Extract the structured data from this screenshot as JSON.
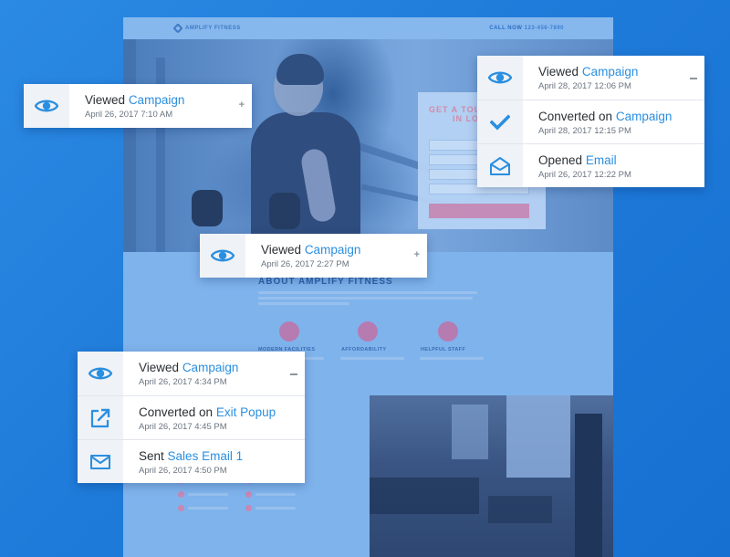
{
  "background_page": {
    "brand": "AMPLIFY FITNESS",
    "phone_prefix": "CALL NOW",
    "phone_number": "123-456-7890",
    "signup_title": "GET A TOU",
    "signup_title_2": "IN LO",
    "about_heading": "ABOUT AMPLIFY FITNESS",
    "features": [
      "MODERN FACILITIES",
      "AFFORDABILITY",
      "HELPFUL STAFF"
    ]
  },
  "colors": {
    "background": "#1f7bd9",
    "link": "#2a8fe0",
    "icon": "#2a8fe0",
    "icon_cell": "#eff2f6"
  },
  "cards": {
    "card_a": {
      "rows": [
        {
          "icon": "eye-icon",
          "verb": "Viewed",
          "object": "Campaign",
          "date": "April 26, 2017 7:10 AM",
          "toggle": "+"
        }
      ]
    },
    "card_b": {
      "rows": [
        {
          "icon": "eye-icon",
          "verb": "Viewed",
          "object": "Campaign",
          "date": "April 28, 2017 12:06 PM",
          "toggle": "−"
        },
        {
          "icon": "checkmark-icon",
          "verb": "Converted on",
          "object": "Campaign",
          "date": "April 28, 2017 12:15 PM"
        },
        {
          "icon": "envelope-open-icon",
          "verb": "Opened",
          "object": "Email",
          "date": "April 26, 2017 12:22 PM"
        }
      ]
    },
    "card_c": {
      "rows": [
        {
          "icon": "eye-icon",
          "verb": "Viewed",
          "object": "Campaign",
          "date": "April 26, 2017 2:27 PM",
          "toggle": "+"
        }
      ]
    },
    "card_d": {
      "rows": [
        {
          "icon": "eye-icon",
          "verb": "Viewed",
          "object": "Campaign",
          "date": "April 26, 2017 4:34 PM",
          "toggle": "−"
        },
        {
          "icon": "external-link-icon",
          "verb": "Converted on",
          "object": "Exit Popup",
          "date": "April 26, 2017 4:45 PM"
        },
        {
          "icon": "envelope-icon",
          "verb": "Sent",
          "object": "Sales Email 1",
          "date": "April 26, 2017 4:50 PM"
        }
      ]
    }
  }
}
